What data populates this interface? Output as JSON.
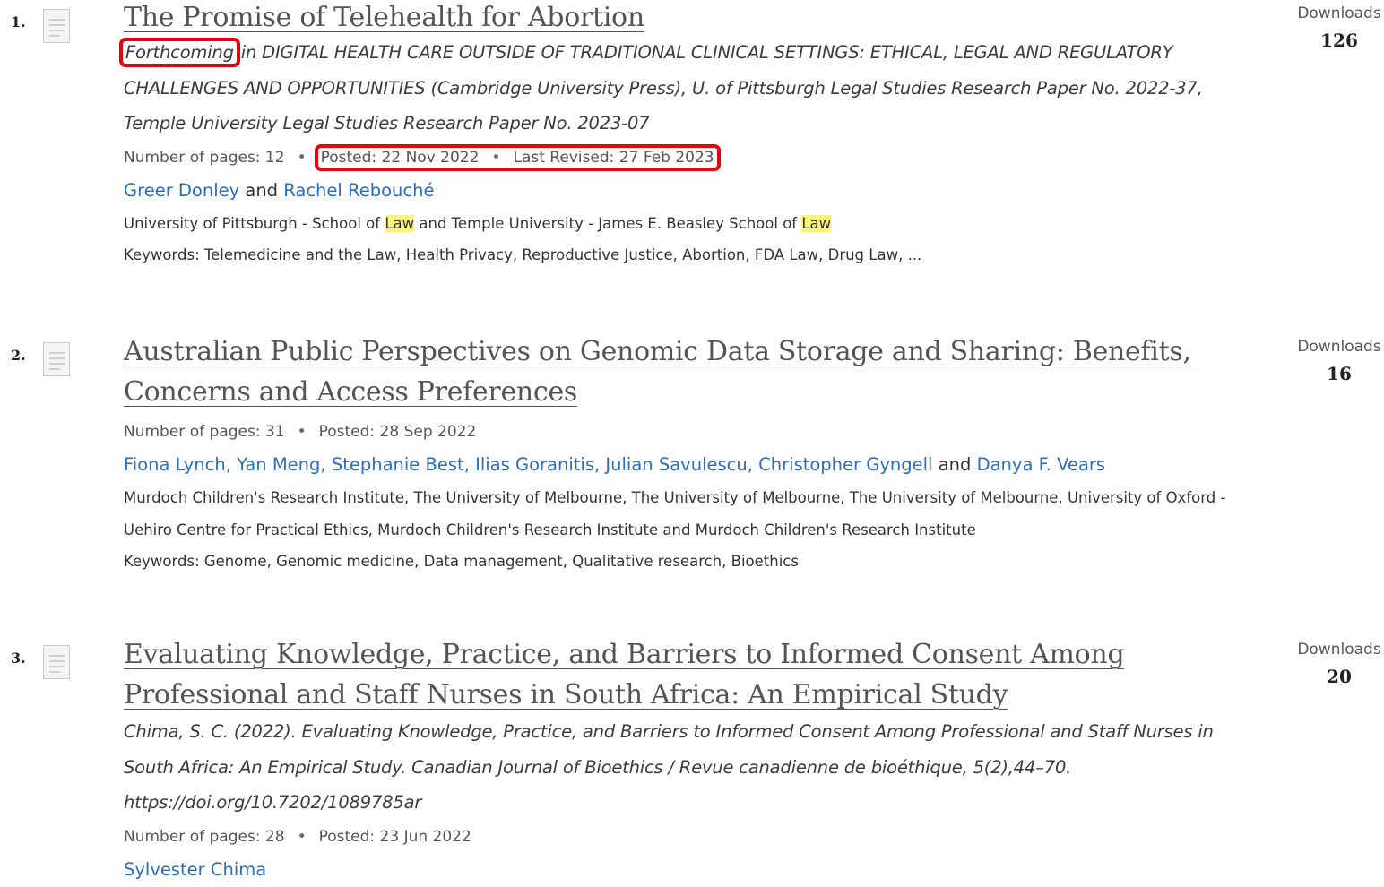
{
  "results": [
    {
      "rank": "1.",
      "title": "The Promise of Telehealth for Abortion",
      "citation_prefix": "Forthcoming",
      "citation_rest": " in DIGITAL HEALTH CARE OUTSIDE OF TRADITIONAL CLINICAL SETTINGS: ETHICAL, LEGAL AND REGULATORY CHALLENGES AND OPPORTUNITIES (Cambridge University Press), U. of Pittsburgh Legal Studies Research Paper No. 2022-37, Temple University Legal Studies Research Paper No. 2023-07",
      "pages": "Number of pages: 12",
      "posted": "Posted: 22 Nov 2022",
      "revised": "Last Revised: 27 Feb 2023",
      "authors": [
        "Greer Donley",
        "Rachel Rebouché"
      ],
      "and": "and",
      "affil_1": "University of Pittsburgh - School of ",
      "affil_hl_1": "Law",
      "affil_2": " and Temple University - James E. Beasley School of ",
      "affil_hl_2": "Law",
      "keywords": "Keywords: Telemedicine and the Law, Health Privacy, Reproductive Justice, Abortion, FDA Law, Drug Law, ...",
      "downloads_label": "Downloads",
      "downloads": "126"
    },
    {
      "rank": "2.",
      "title": "Australian Public Perspectives on Genomic Data Storage and Sharing: Benefits, Concerns and Access Preferences",
      "pages": "Number of pages: 31",
      "posted": "Posted: 28 Sep 2022",
      "authors": [
        "Fiona Lynch",
        "Yan Meng",
        "Stephanie Best",
        "Ilias Goranitis",
        "Julian Savulescu",
        "Christopher Gyngell",
        "Danya F. Vears"
      ],
      "and": "and",
      "affiliations": "Murdoch Children's Research Institute, The University of Melbourne, The University of Melbourne, The University of Melbourne, University of Oxford - Uehiro Centre for Practical Ethics, Murdoch Children's Research Institute and Murdoch Children's Research Institute",
      "keywords": "Keywords: Genome, Genomic medicine, Data management, Qualitative research, Bioethics",
      "downloads_label": "Downloads",
      "downloads": "16"
    },
    {
      "rank": "3.",
      "title": "Evaluating Knowledge, Practice, and Barriers to Informed Consent Among Professional and Staff Nurses in South Africa: An Empirical Study",
      "citation": "Chima, S. C. (2022). Evaluating Knowledge, Practice, and Barriers to Informed Consent Among Professional and Staff Nurses in South Africa: An Empirical Study. Canadian Journal of Bioethics / Revue canadienne de bioéthique, 5(2),44–70. https://doi.org/10.7202/1089785ar",
      "pages": "Number of pages: 28",
      "posted": "Posted: 23 Jun 2022",
      "authors": [
        "Sylvester Chima"
      ],
      "downloads_label": "Downloads",
      "downloads": "20"
    }
  ],
  "separator": "•",
  "colors": {
    "link": "#2a6ebb",
    "highlight": "#fff47a",
    "annotation_box": "#e8000b"
  }
}
